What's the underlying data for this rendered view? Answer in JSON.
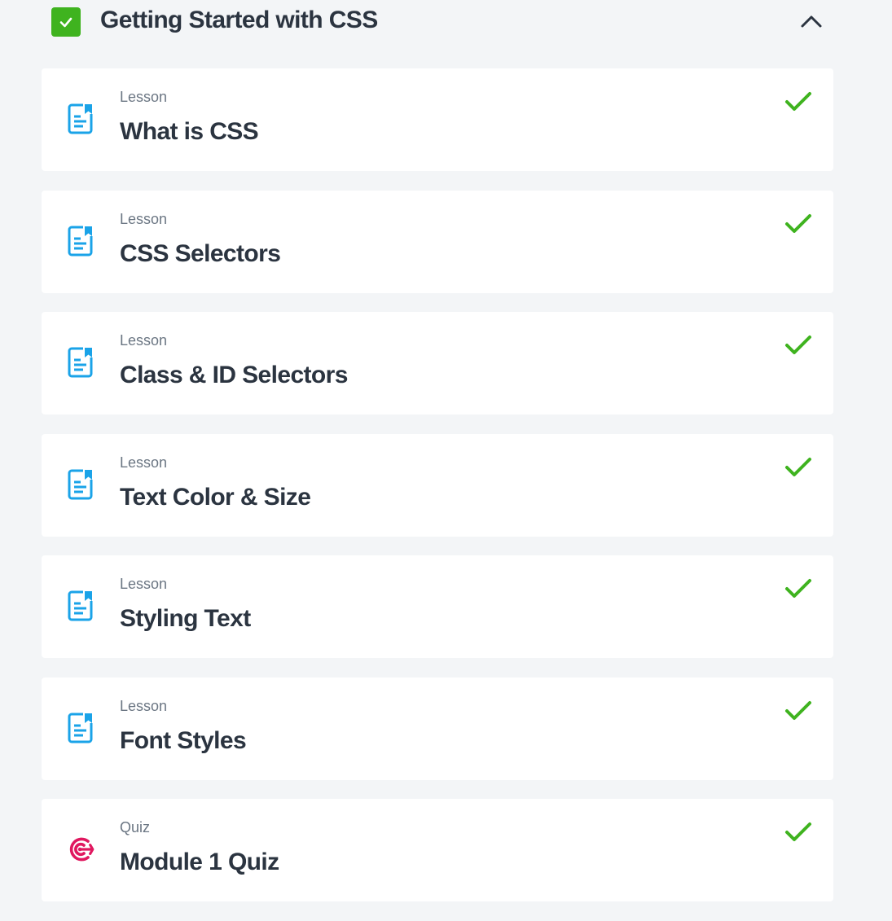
{
  "module": {
    "title": "Getting Started with CSS",
    "status_icon": "checkbox-checked-icon",
    "toggle_icon": "chevron-up-icon",
    "accent_color": "#3fb31f"
  },
  "items": [
    {
      "type": "Lesson",
      "title": "What is CSS",
      "icon": "lesson-document-icon",
      "completed": true
    },
    {
      "type": "Lesson",
      "title": "CSS Selectors",
      "icon": "lesson-document-icon",
      "completed": true
    },
    {
      "type": "Lesson",
      "title": "Class & ID Selectors",
      "icon": "lesson-document-icon",
      "completed": true
    },
    {
      "type": "Lesson",
      "title": "Text Color & Size",
      "icon": "lesson-document-icon",
      "completed": true
    },
    {
      "type": "Lesson",
      "title": "Styling Text",
      "icon": "lesson-document-icon",
      "completed": true
    },
    {
      "type": "Lesson",
      "title": "Font Styles",
      "icon": "lesson-document-icon",
      "completed": true
    },
    {
      "type": "Quiz",
      "title": "Module 1 Quiz",
      "icon": "quiz-target-icon",
      "completed": true
    }
  ],
  "colors": {
    "lesson_icon": "#1aa3e8",
    "quiz_icon": "#e0185f",
    "check": "#3fb31f",
    "title_text": "#2b3440",
    "type_text": "#6b7683",
    "background": "#f3f5f7"
  }
}
